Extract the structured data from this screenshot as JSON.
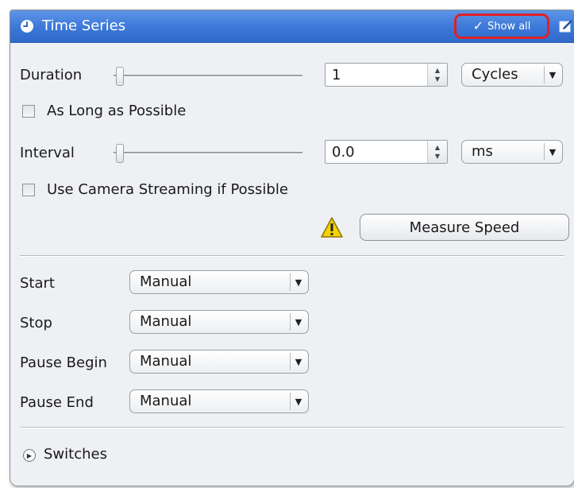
{
  "header": {
    "title": "Time Series",
    "show_all_label": "Show all"
  },
  "duration": {
    "label": "Duration",
    "value": "1",
    "unit": "Cycles",
    "slider_level": 0
  },
  "as_long_as_possible": {
    "label": "As Long as Possible",
    "checked": false
  },
  "interval": {
    "label": "Interval",
    "value": "0.0",
    "unit": "ms",
    "slider_level": 0
  },
  "camera_streaming": {
    "label": "Use Camera Streaming if Possible",
    "checked": false
  },
  "measure_speed": {
    "label": "Measure Speed",
    "warning_icon": "warning-icon"
  },
  "triggers": [
    {
      "label": "Start",
      "value": "Manual"
    },
    {
      "label": "Stop",
      "value": "Manual"
    },
    {
      "label": "Pause Begin",
      "value": "Manual"
    },
    {
      "label": "Pause End",
      "value": "Manual"
    }
  ],
  "switches": {
    "label": "Switches",
    "expanded": false
  },
  "colors": {
    "header_blue": "#3c78d8",
    "highlight_red": "#e11f26",
    "warning_yellow": "#f5d300"
  }
}
